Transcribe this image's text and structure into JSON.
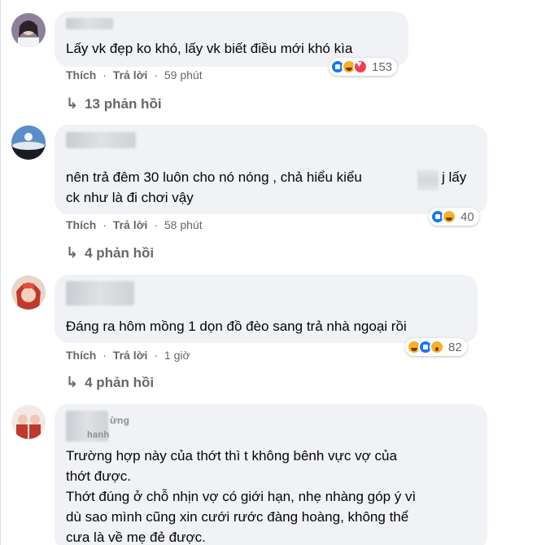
{
  "actions": {
    "like": "Thích",
    "reply": "Trả lời",
    "sep": "·"
  },
  "comments": [
    {
      "name_fragment": "",
      "lines": [
        "Lấy vk đẹp ko khó, lấy vk biết điều mới khó kìa"
      ],
      "time": "59 phút",
      "reactions": [
        "like",
        "haha",
        "love"
      ],
      "reaction_count": "153",
      "replies": "13 phản hồi"
    },
    {
      "name_fragment": "",
      "lines": [
        "nên trả đêm 30 luôn cho nó nóng , chả hiểu kiểu",
        "j lấy",
        "ck như là đi chơi vậy"
      ],
      "time": "58 phút",
      "reactions": [
        "like",
        "haha"
      ],
      "reaction_count": "40",
      "replies": "4 phản hồi"
    },
    {
      "name_fragment": "",
      "lines": [
        "Đáng ra hôm mồng 1 dọn đồ đèo sang trả nhà ngoại rồi"
      ],
      "time": "1 giờ",
      "reactions": [
        "haha",
        "like",
        "wow"
      ],
      "reaction_count": "82",
      "replies": "4 phản hồi"
    },
    {
      "name_fragment": "ừng",
      "name_fragment2": "hanh",
      "lines": [
        "Trường hợp này của thớt thì t không bênh vực vợ của",
        "thớt được.",
        "Thớt đúng ở chỗ nhịn vợ có giới hạn, nhẹ nhàng góp ý vì",
        "dù sao mình cũng xin cưới rước đàng hoàng, không thể",
        "cưa là về mẹ đẻ được."
      ]
    }
  ],
  "colors": {
    "like": "#1877f2",
    "haha": "#f7b125",
    "love": "#f33e58",
    "muted": "#65676b",
    "bubble": "#f0f2f5"
  }
}
